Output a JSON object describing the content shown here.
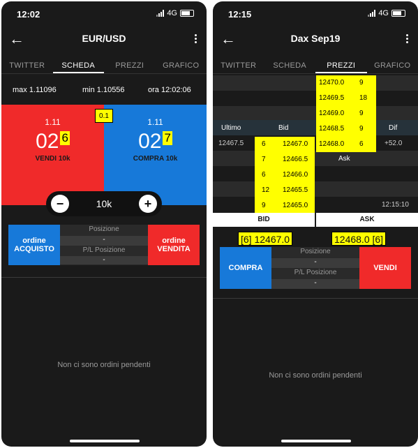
{
  "left": {
    "status_time": "12:02",
    "network": "4G",
    "title": "EUR/USD",
    "tabs": [
      "TWITTER",
      "SCHEDA",
      "PREZZI",
      "GRAFICO"
    ],
    "stats": {
      "max": "max 1.11096",
      "min": "min 1.10556",
      "time": "ora 12:02:06"
    },
    "sell": {
      "small": "1.11",
      "big": "02",
      "pip": "6",
      "label": "VENDI 10k"
    },
    "buy": {
      "small": "1.11",
      "big": "02",
      "pip": "7",
      "label": "COMPRA 10k"
    },
    "spread": "0.1",
    "stepper": {
      "minus": "−",
      "value": "10k",
      "plus": "+"
    },
    "buy_order": {
      "line1": "ordine",
      "line2": "ACQUISTO"
    },
    "sell_order": {
      "line1": "ordine",
      "line2": "VENDITA"
    },
    "position_label": "Posizione",
    "position_value": "-",
    "pl_label": "P/L Posizione",
    "pl_value": "-",
    "empty_text": "Non ci sono ordini pendenti"
  },
  "right": {
    "status_time": "12:15",
    "network": "4G",
    "title": "Dax Sep19",
    "tabs": [
      "TWITTER",
      "SCHEDA",
      "PREZZI",
      "GRAFICO"
    ],
    "ask_levels": [
      {
        "price": "12470.0",
        "size": "9"
      },
      {
        "price": "12469.5",
        "size": "18"
      },
      {
        "price": "12469.0",
        "size": "9"
      },
      {
        "price": "12468.5",
        "size": "9"
      },
      {
        "price": "12468.0",
        "size": "6"
      }
    ],
    "bid_levels": [
      {
        "size": "6",
        "price": "12467.0"
      },
      {
        "size": "7",
        "price": "12466.5"
      },
      {
        "size": "6",
        "price": "12466.0"
      },
      {
        "size": "12",
        "price": "12465.5"
      },
      {
        "size": "9",
        "price": "12465.0"
      }
    ],
    "headers": {
      "last": "Ultimo",
      "bid": "Bid",
      "ask": "Ask",
      "change": "Dif"
    },
    "last_value": "12467.5",
    "change_value": "+52.0",
    "update_time": "12:15:10",
    "bid_label": "BID",
    "ask_label": "ASK",
    "bid_quote": "[6] 12467.0",
    "ask_quote": "12468.0 [6]",
    "buy_button": "COMPRA",
    "sell_button": "VENDI",
    "position_label": "Posizione",
    "position_value": "-",
    "pl_label": "P/L Posizione",
    "pl_value": "-",
    "empty_text": "Non ci sono ordini pendenti"
  },
  "colors": {
    "sell": "#f02a2a",
    "buy": "#1779d9",
    "highlight": "#ffff00",
    "background": "#1a1a1a"
  },
  "icons": [
    "back-arrow-icon",
    "more-icon",
    "signal-icon",
    "battery-icon",
    "minus-icon",
    "plus-icon"
  ]
}
